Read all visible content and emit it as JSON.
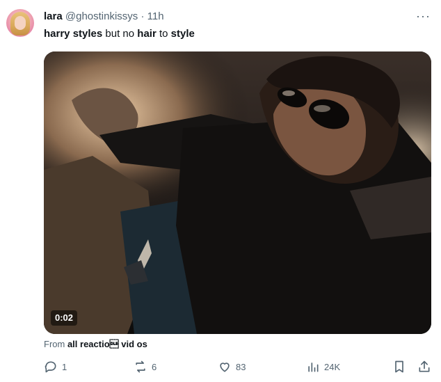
{
  "user": {
    "display_name": "lara",
    "handle": "@ghostinkissys",
    "separator": "·",
    "time": "11h"
  },
  "tweet": {
    "text_parts": [
      "harry styles",
      " but no ",
      "hair",
      " to ",
      "style"
    ]
  },
  "media": {
    "type": "video",
    "duration": "0:02"
  },
  "source": {
    "prefix": "From ",
    "name": "all reactio\u0010 vid os"
  },
  "actions": {
    "reply_count": "1",
    "repost_count": "6",
    "like_count": "83",
    "views_count": "24K"
  },
  "icons": {
    "more": "more-horizontal-icon",
    "reply": "reply-icon",
    "repost": "repost-icon",
    "like": "like-icon",
    "views": "views-icon",
    "bookmark": "bookmark-icon",
    "share": "share-icon"
  },
  "colors": {
    "text_primary": "#0f1419",
    "text_secondary": "#536471",
    "background": "#ffffff"
  }
}
